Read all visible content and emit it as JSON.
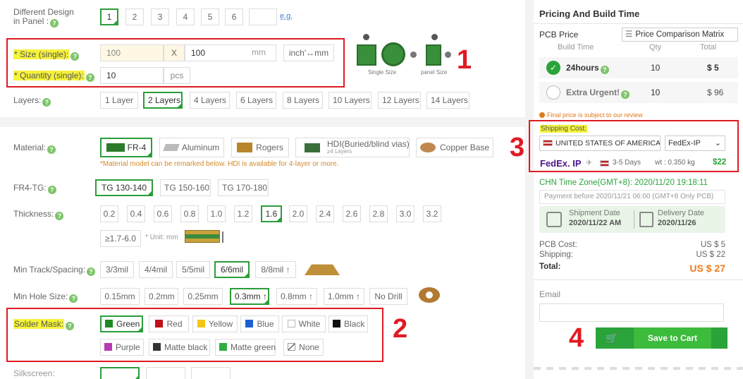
{
  "form": {
    "design_panel": {
      "label_line1": "Different Design",
      "label_line2": "in Panel :",
      "options": [
        "1",
        "2",
        "3",
        "4",
        "5",
        "6"
      ],
      "eg_link": "e.g."
    },
    "size": {
      "label": "* Size (single):",
      "width_value": "100",
      "x_sep": "X",
      "height_value": "100",
      "unit": "mm",
      "convert_button": "inch'↔mm",
      "single_size_caption": "Single Size",
      "panel_size_caption": "panel Size"
    },
    "quantity": {
      "label": "* Quantity (single):",
      "value": "10",
      "unit": "pcs"
    },
    "layers": {
      "label": "Layers:",
      "options": [
        "1 Layer",
        "2 Layers",
        "4 Layers",
        "6 Layers",
        "8 Layers",
        "10 Layers",
        "12 Layers",
        "14 Layers"
      ],
      "selected": "2 Layers"
    },
    "material": {
      "label": "Material:",
      "options": [
        "FR-4",
        "Aluminum",
        "Rogers",
        "HDI(Buried/blind vias)",
        "Copper Base"
      ],
      "hdi_sub": "≥4 Layers",
      "note": "*Material model can be remarked below. HDI is available for 4-layer or more.",
      "selected": "FR-4"
    },
    "fr4_tg": {
      "label": "FR4-TG:",
      "options": [
        "TG 130-140",
        "TG 150-160",
        "TG 170-180"
      ],
      "selected": "TG 130-140"
    },
    "thickness": {
      "label": "Thickness:",
      "options": [
        "0.2",
        "0.4",
        "0.6",
        "0.8",
        "1.0",
        "1.2",
        "1.6",
        "2.0",
        "2.4",
        "2.6",
        "2.8",
        "3.0",
        "3.2"
      ],
      "selected": "1.6",
      "extra_option": "≥1.7-6.0",
      "unit_note": "* Unit: mm"
    },
    "track_spacing": {
      "label": "Min Track/Spacing:",
      "options": [
        "3/3mil",
        "4/4mil",
        "5/5mil",
        "6/6mil",
        "8/8mil ↑"
      ],
      "selected": "6/6mil"
    },
    "hole_size": {
      "label": "Min Hole Size:",
      "options": [
        "0.15mm",
        "0.2mm",
        "0.25mm",
        "0.3mm ↑",
        "0.8mm ↑",
        "1.0mm ↑",
        "No Drill"
      ],
      "selected": "0.3mm ↑"
    },
    "solder_mask": {
      "label": "Solder Mask:",
      "options": [
        "Green",
        "Red",
        "Yellow",
        "Blue",
        "White",
        "Black",
        "Purple",
        "Matte black",
        "Matte green",
        "None"
      ],
      "selected": "Green"
    },
    "silkscreen": {
      "label": "Silkscreen:"
    }
  },
  "swatches": {
    "Green": "#1e8a24",
    "Red": "#c0111a",
    "Yellow": "#f5c518",
    "Blue": "#1f5fd6",
    "White": "#ffffff",
    "Black": "#111111",
    "Purple": "#b53bb5",
    "Matte black": "#333333",
    "Matte green": "#2fae44",
    "None": "#ffffff"
  },
  "annotations": {
    "n1": "1",
    "n2": "2",
    "n3": "3",
    "n4": "4"
  },
  "panel": {
    "title": "Pricing And Build Time",
    "pcb_price_label": "PCB Price",
    "compare_button": "Price Comparison Matrix",
    "headers": {
      "build_time": "Build Time",
      "qty": "Qty",
      "total": "Total"
    },
    "build_options": [
      {
        "name": "24hours",
        "qty": "10",
        "total": "$ 5",
        "selected": true
      },
      {
        "name": "Extra Urgent!",
        "qty": "10",
        "total": "$ 96",
        "selected": false
      }
    ],
    "final_price_note": "Final price is subject to our review",
    "shipping": {
      "label": "Shipping Cost:",
      "country": "UNITED STATES OF AMERICA",
      "method": "FedEx-IP",
      "carrier_logo": "FedEx. IP",
      "days": "3-5 Days",
      "weight": "wt : 0.350 kg",
      "price": "$22"
    },
    "timezone": "CHN Time Zone(GMT+8): 2020/11/20 19:18:11",
    "payment_before": "Payment before 2020/11/21 06:00 (GMT+8 Only PCB)",
    "shipment_label": "Shipment Date",
    "shipment_date": "2020/11/22 AM",
    "delivery_label": "Delivery Date",
    "delivery_date": "2020/11/26",
    "pcb_cost_label": "PCB Cost:",
    "pcb_cost": "US $ 5",
    "shipping_label": "Shipping:",
    "shipping_cost": "US $ 22",
    "total_label": "Total:",
    "total": "US $ 27",
    "email_label": "Email",
    "email_value": "",
    "save_button": "Save to Cart"
  },
  "colors": {
    "accent_green": "#2aa33a",
    "annotation_red": "#e01a22",
    "highlight_yellow": "#f5f33a",
    "total_orange": "#f07a1a"
  }
}
